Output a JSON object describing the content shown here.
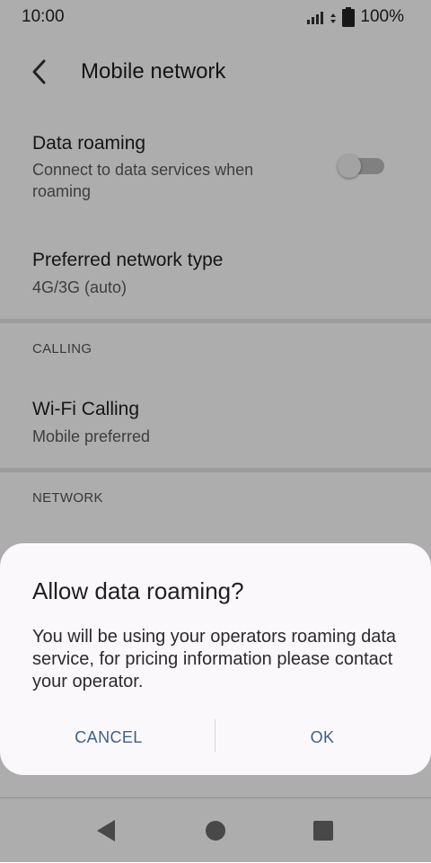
{
  "status_bar": {
    "time": "10:00",
    "battery": "100%"
  },
  "header": {
    "title": "Mobile network"
  },
  "settings": {
    "data_roaming": {
      "title": "Data roaming",
      "subtitle": "Connect to data services when roaming",
      "enabled": false
    },
    "preferred_network": {
      "title": "Preferred network type",
      "value": "4G/3G (auto)"
    },
    "calling_header": "CALLING",
    "wifi_calling": {
      "title": "Wi-Fi Calling",
      "value": "Mobile preferred"
    },
    "network_header": "NETWORK"
  },
  "dialog": {
    "title": "Allow data roaming?",
    "message": "You will be using your operators roaming data service, for pricing information please contact your operator.",
    "cancel_label": "CANCEL",
    "ok_label": "OK",
    "button_color": "#3f5f86"
  },
  "nav_icons": [
    "back-triangle-icon",
    "home-circle-icon",
    "recents-square-icon"
  ]
}
